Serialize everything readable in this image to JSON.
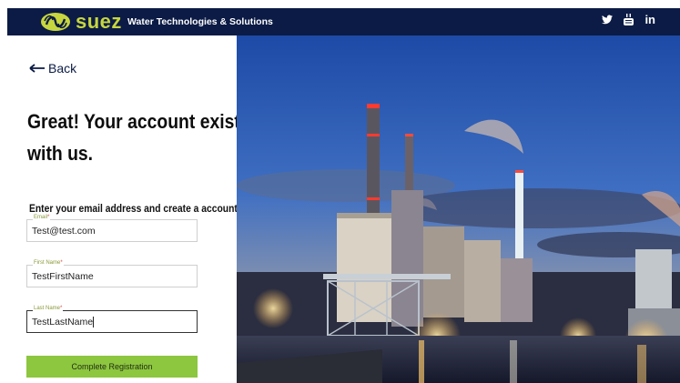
{
  "header": {
    "brand_name": "SUEZ",
    "tagline": "Water Technologies & Solutions",
    "colors": {
      "bar": "#0b1b45",
      "logo": "#c7d63e"
    },
    "social_icons": [
      "twitter-icon",
      "youtube-icon",
      "linkedin-icon"
    ],
    "linkedin_text": "in"
  },
  "nav": {
    "back_label": "Back"
  },
  "content": {
    "headline_line1": "Great! Your account exists",
    "headline_line2": "with us.",
    "instruction": "Enter your email address and create a account"
  },
  "form": {
    "email": {
      "label": "Email",
      "value": "Test@test.com"
    },
    "first_name": {
      "label": "First Name",
      "value": "TestFirstName"
    },
    "last_name": {
      "label": "Last Name",
      "value": "TestLastName"
    },
    "submit_label": "Complete Registration",
    "submit_color": "#8dc63f"
  },
  "hero": {
    "subject": "industrial plant at dusk"
  }
}
